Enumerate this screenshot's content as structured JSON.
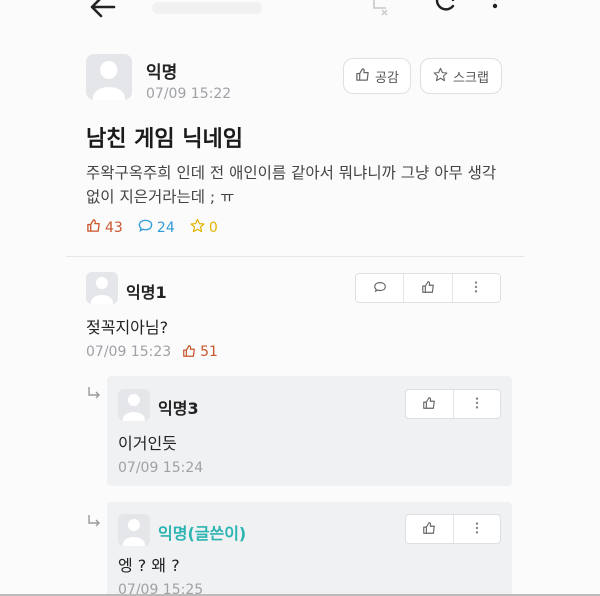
{
  "post": {
    "author": "익명",
    "time": "07/09 15:22",
    "empathy_label": "공감",
    "scrap_label": "스크랩",
    "title": "남친 게임 닉네임",
    "body": "주왁구옥주희 인데 전 애인이름 같아서 뭐냐니까 그냥 아무 생각없이 지은거라는데 ; ㅠ",
    "likes": "43",
    "comments": "24",
    "scraps": "0"
  },
  "comment1": {
    "author": "익명1",
    "text": "젖꼭지아님?",
    "time": "07/09 15:23",
    "likes": "51"
  },
  "reply1": {
    "author": "익명3",
    "text": "이거인듯",
    "time": "07/09 15:24"
  },
  "reply2": {
    "author": "익명(글쓴이)",
    "text": "엥 ? 왜 ?",
    "time": "07/09 15:25"
  },
  "colors": {
    "like": "#c9562b",
    "comment": "#2f9cd8",
    "scrap": "#e0b400",
    "op_name": "#2bb4b0",
    "muted": "#9ea1a6"
  },
  "icons": [
    "back-arrow-icon",
    "clear-icon",
    "refresh-icon",
    "more-vertical-icon",
    "thumbs-up-icon",
    "star-icon",
    "speech-bubble-icon",
    "reply-arrow-icon",
    "avatar-icon"
  ]
}
